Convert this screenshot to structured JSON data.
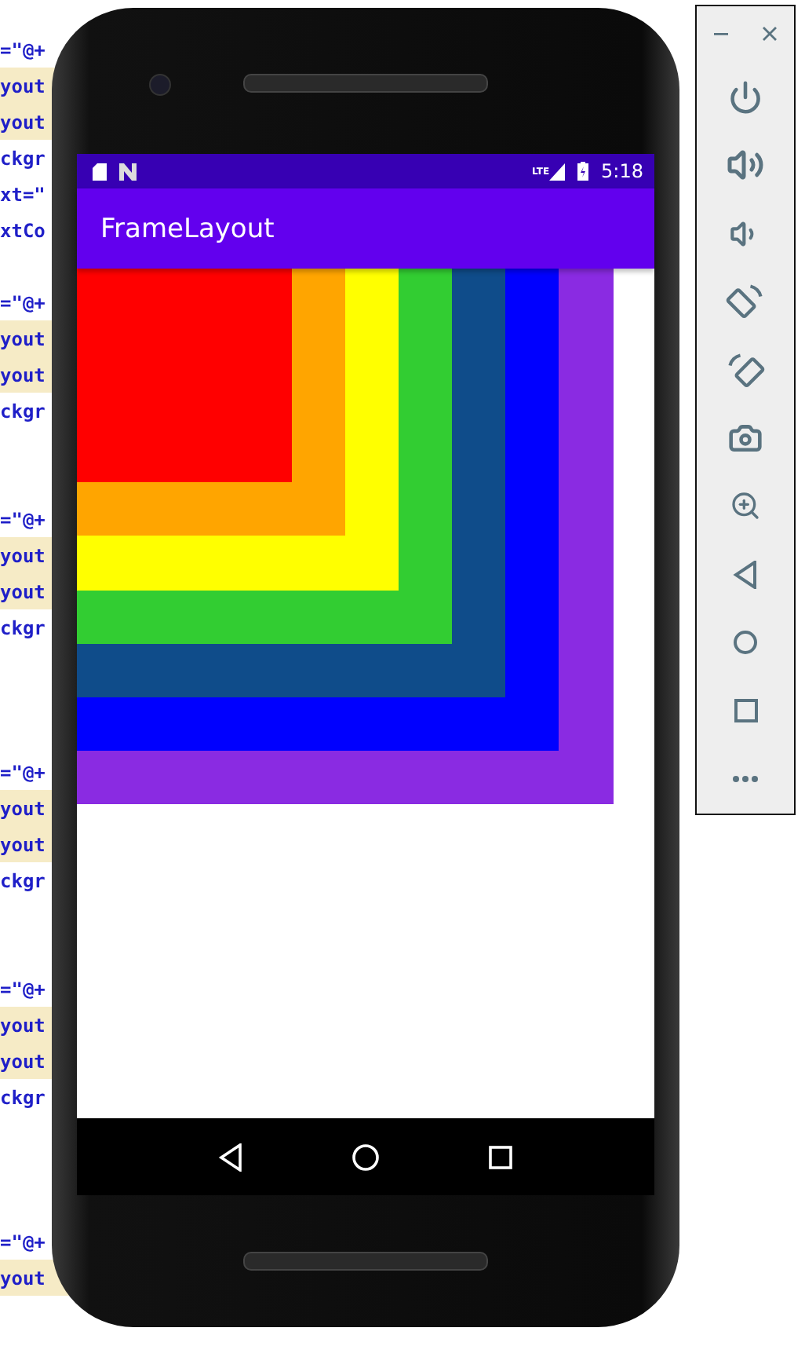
{
  "editor": {
    "lines": [
      {
        "kind": "code",
        "text": "=\"@+",
        "highlighted": false
      },
      {
        "kind": "code",
        "text": "yout",
        "highlighted": true
      },
      {
        "kind": "code",
        "text": "yout",
        "highlighted": true
      },
      {
        "kind": "code",
        "text": "ckgr",
        "highlighted": false
      },
      {
        "kind": "code",
        "text": "xt=\"",
        "highlighted": false
      },
      {
        "kind": "code",
        "text": "xtCo",
        "highlighted": false
      },
      {
        "kind": "blank"
      },
      {
        "kind": "code",
        "text": "=\"@+",
        "highlighted": false
      },
      {
        "kind": "code",
        "text": "yout",
        "highlighted": true
      },
      {
        "kind": "code",
        "text": "yout",
        "highlighted": true
      },
      {
        "kind": "code",
        "text": "ckgr",
        "highlighted": false
      },
      {
        "kind": "blank"
      },
      {
        "kind": "blank"
      },
      {
        "kind": "code",
        "text": "=\"@+",
        "highlighted": false
      },
      {
        "kind": "code",
        "text": "yout",
        "highlighted": true
      },
      {
        "kind": "code",
        "text": "yout",
        "highlighted": true
      },
      {
        "kind": "code",
        "text": "ckgr",
        "highlighted": false
      },
      {
        "kind": "blank"
      },
      {
        "kind": "blank"
      },
      {
        "kind": "blank"
      },
      {
        "kind": "code",
        "text": "=\"@+",
        "highlighted": false
      },
      {
        "kind": "code",
        "text": "yout",
        "highlighted": true
      },
      {
        "kind": "code",
        "text": "yout",
        "highlighted": true
      },
      {
        "kind": "code",
        "text": "ckgr",
        "highlighted": false
      },
      {
        "kind": "blank"
      },
      {
        "kind": "blank"
      },
      {
        "kind": "code",
        "text": "=\"@+",
        "highlighted": false
      },
      {
        "kind": "code",
        "text": "yout",
        "highlighted": true
      },
      {
        "kind": "code",
        "text": "yout",
        "highlighted": true
      },
      {
        "kind": "code",
        "text": "ckgr",
        "highlighted": false
      },
      {
        "kind": "blank"
      },
      {
        "kind": "blank"
      },
      {
        "kind": "blank"
      },
      {
        "kind": "code",
        "text": "=\"@+",
        "highlighted": false
      },
      {
        "kind": "code",
        "text": "yout",
        "highlighted": true
      }
    ]
  },
  "device": {
    "status_bar": {
      "network": "LTE",
      "time": "5:18"
    },
    "app_bar": {
      "title": "FrameLayout"
    },
    "views": [
      {
        "color": "#8a2be2"
      },
      {
        "color": "#0000ff"
      },
      {
        "color": "#0f4c8a"
      },
      {
        "color": "#32cd32"
      },
      {
        "color": "#ffff00"
      },
      {
        "color": "#ffa500"
      },
      {
        "color": "#ff0000"
      }
    ]
  }
}
